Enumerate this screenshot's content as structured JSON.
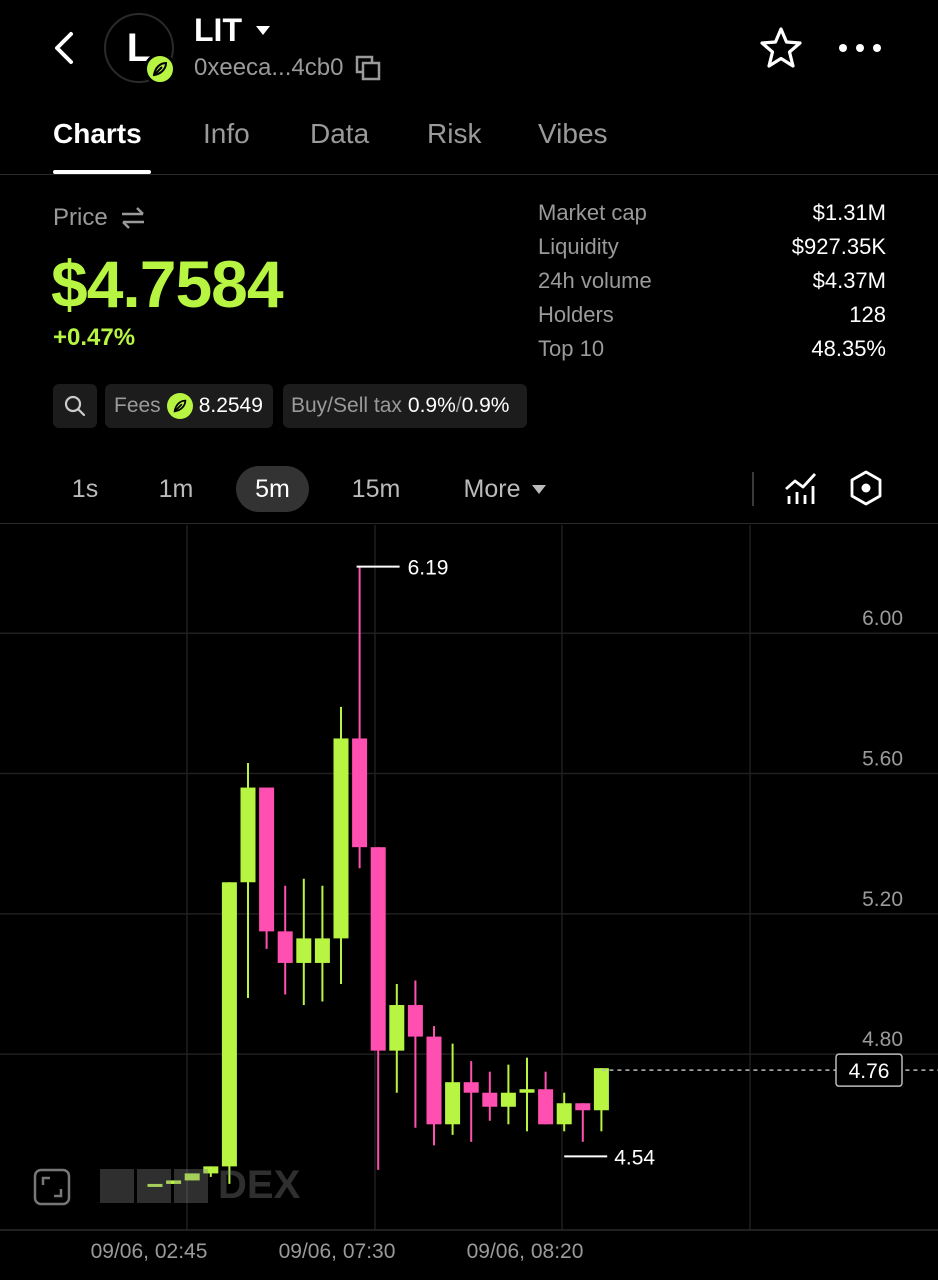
{
  "header": {
    "avatar_letter": "L",
    "token_name": "LIT",
    "address": "0xeeca...4cb0",
    "icons": [
      "back-arrow-icon",
      "leaf-badge-icon",
      "caret-down-icon",
      "copy-icon",
      "star-icon",
      "more-icon"
    ]
  },
  "tabs": [
    {
      "label": "Charts",
      "active": true
    },
    {
      "label": "Info",
      "active": false
    },
    {
      "label": "Data",
      "active": false
    },
    {
      "label": "Risk",
      "active": false
    },
    {
      "label": "Vibes",
      "active": false
    }
  ],
  "price": {
    "label": "Price",
    "value": "$4.7584",
    "change": "+0.47%"
  },
  "stats": [
    {
      "label": "Market cap",
      "value": "$1.31M"
    },
    {
      "label": "Liquidity",
      "value": "$927.35K"
    },
    {
      "label": "24h volume",
      "value": "$4.37M"
    },
    {
      "label": "Holders",
      "value": "128"
    },
    {
      "label": "Top 10",
      "value": "48.35%"
    }
  ],
  "chips": {
    "fees_label": "Fees",
    "fees_value": "8.2549",
    "tax_label": "Buy/Sell tax",
    "tax_buy": "0.9%",
    "tax_sep": "/",
    "tax_sell": "0.9%"
  },
  "intervals": {
    "items": [
      {
        "label": "1s",
        "active": false
      },
      {
        "label": "1m",
        "active": false
      },
      {
        "label": "5m",
        "active": true
      },
      {
        "label": "15m",
        "active": false
      }
    ],
    "more_label": "More"
  },
  "colors": {
    "up": "#b7f542",
    "down": "#ff4fb0",
    "background": "#000000",
    "accent": "#b7f542"
  },
  "watermark": {
    "text": "DEX"
  },
  "chart_data": {
    "type": "candlestick",
    "ylim": [
      4.33,
      6.28
    ],
    "y_ticks": [
      "6.00",
      "5.60",
      "5.20",
      "4.80"
    ],
    "x_ticks": [
      "09/06, 02:45",
      "09/06, 07:30",
      "09/06, 08:20"
    ],
    "current_price_label": "4.76",
    "high_label": "6.19",
    "low_label": "4.54",
    "grid": true,
    "candles": [
      {
        "o": 4.43,
        "h": 4.43,
        "l": 4.43,
        "c": 4.43
      },
      {
        "o": 4.43,
        "h": 4.44,
        "l": 4.43,
        "c": 4.44
      },
      {
        "o": 4.44,
        "h": 4.46,
        "l": 4.44,
        "c": 4.46
      },
      {
        "o": 4.46,
        "h": 4.48,
        "l": 4.45,
        "c": 4.48
      },
      {
        "o": 4.48,
        "h": 5.29,
        "l": 4.43,
        "c": 5.29
      },
      {
        "o": 5.29,
        "h": 5.63,
        "l": 4.96,
        "c": 5.56
      },
      {
        "o": 5.56,
        "h": 5.56,
        "l": 5.1,
        "c": 5.15
      },
      {
        "o": 5.15,
        "h": 5.28,
        "l": 4.97,
        "c": 5.06
      },
      {
        "o": 5.06,
        "h": 5.3,
        "l": 4.94,
        "c": 5.13
      },
      {
        "o": 5.06,
        "h": 5.28,
        "l": 4.95,
        "c": 5.13
      },
      {
        "o": 5.13,
        "h": 5.79,
        "l": 5.0,
        "c": 5.7
      },
      {
        "o": 5.7,
        "h": 6.19,
        "l": 5.33,
        "c": 5.39
      },
      {
        "o": 5.39,
        "h": 5.39,
        "l": 4.47,
        "c": 4.81
      },
      {
        "o": 4.81,
        "h": 5.0,
        "l": 4.69,
        "c": 4.94
      },
      {
        "o": 4.94,
        "h": 5.01,
        "l": 4.59,
        "c": 4.85
      },
      {
        "o": 4.85,
        "h": 4.88,
        "l": 4.54,
        "c": 4.6
      },
      {
        "o": 4.6,
        "h": 4.83,
        "l": 4.57,
        "c": 4.72
      },
      {
        "o": 4.72,
        "h": 4.78,
        "l": 4.55,
        "c": 4.69
      },
      {
        "o": 4.69,
        "h": 4.75,
        "l": 4.61,
        "c": 4.65
      },
      {
        "o": 4.65,
        "h": 4.77,
        "l": 4.6,
        "c": 4.69
      },
      {
        "o": 4.69,
        "h": 4.79,
        "l": 4.58,
        "c": 4.7
      },
      {
        "o": 4.7,
        "h": 4.75,
        "l": 4.6,
        "c": 4.6
      },
      {
        "o": 4.6,
        "h": 4.69,
        "l": 4.58,
        "c": 4.66
      },
      {
        "o": 4.66,
        "h": 4.66,
        "l": 4.55,
        "c": 4.64
      },
      {
        "o": 4.64,
        "h": 4.76,
        "l": 4.58,
        "c": 4.76
      }
    ]
  }
}
